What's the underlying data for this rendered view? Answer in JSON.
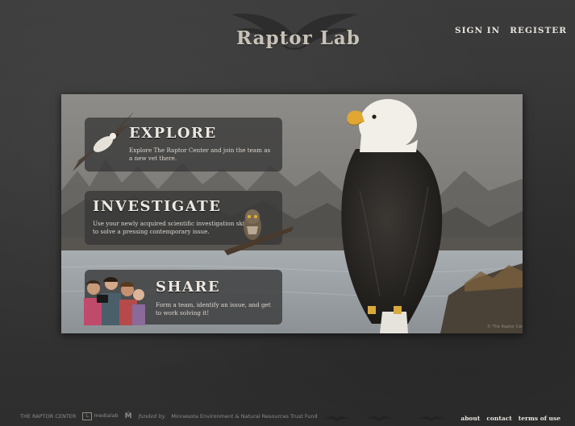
{
  "header": {
    "logo_text": "Raptor Lab",
    "nav": {
      "sign_in": "SIGN IN",
      "register": "REGISTER"
    }
  },
  "cards": {
    "explore": {
      "title": "EXPLORE",
      "description": "Explore The Raptor Center and join the team as a new vet there."
    },
    "investigate": {
      "title": "INVESTIGATE",
      "description": "Use your newly acquired scientific investigation skills to solve a pressing contemporary issue."
    },
    "share": {
      "title": "SHARE",
      "description": "Form a team, identify an issue, and get to work solving it!"
    }
  },
  "footer": {
    "raptor_center": "THE RAPTOR CENTER",
    "media_lab": "medialab",
    "funded_by": "funded by",
    "fund_name": "Minnesota Environment & Natural Resources Trust Fund",
    "nav": {
      "about": "about",
      "contact": "contact",
      "terms": "terms of use"
    }
  },
  "colors": {
    "background": "#3a3a3a",
    "card": "#373737",
    "text_light": "#ece8e1"
  }
}
